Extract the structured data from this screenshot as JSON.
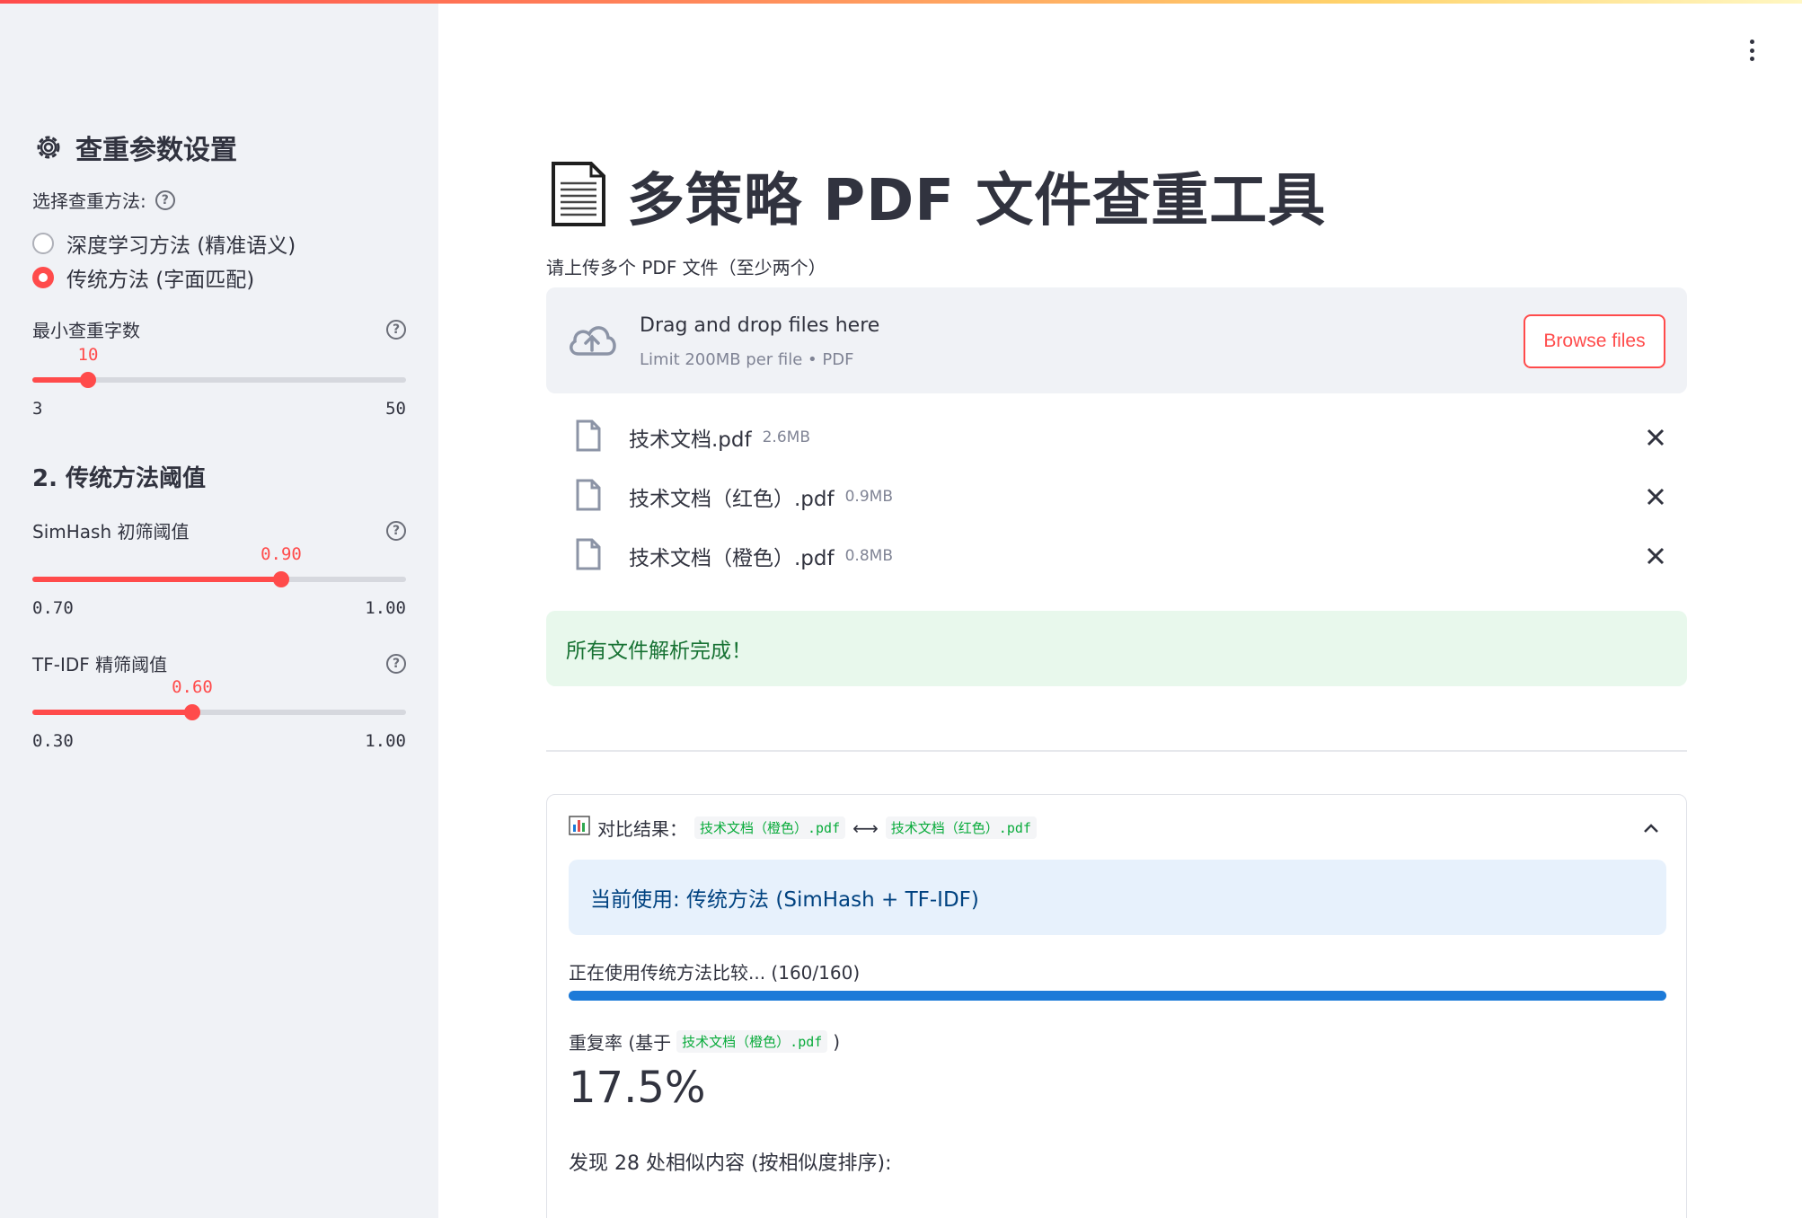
{
  "sidebar": {
    "header": "查重参数设置",
    "method_label": "选择查重方法:",
    "methods": [
      {
        "label": "深度学习方法 (精准语义)",
        "selected": false
      },
      {
        "label": "传统方法 (字面匹配)",
        "selected": true
      }
    ],
    "min_len": {
      "label": "最小查重字数",
      "value": "10",
      "min": "3",
      "max": "50",
      "fraction": 0.149
    },
    "section2": "2. 传统方法阈值",
    "simhash": {
      "label": "SimHash 初筛阈值",
      "value": "0.90",
      "min": "0.70",
      "max": "1.00",
      "fraction": 0.667
    },
    "tfidf": {
      "label": "TF-IDF 精筛阈值",
      "value": "0.60",
      "min": "0.30",
      "max": "1.00",
      "fraction": 0.429
    }
  },
  "main": {
    "title": "多策略 PDF 文件查重工具",
    "upload_label": "请上传多个 PDF 文件（至少两个）",
    "dropzone": {
      "title": "Drag and drop files here",
      "limit": "Limit 200MB per file • PDF",
      "browse": "Browse files"
    },
    "files": [
      {
        "name": "技术文档.pdf",
        "size": "2.6MB"
      },
      {
        "name": "技术文档（红色）.pdf",
        "size": "0.9MB"
      },
      {
        "name": "技术文档（橙色）.pdf",
        "size": "0.8MB"
      }
    ],
    "success_msg": "所有文件解析完成！",
    "expander": {
      "prefix": "对比结果：",
      "file_a": "技术文档（橙色）.pdf",
      "arrow": "⟷",
      "file_b": "技术文档（红色）.pdf",
      "info": "当前使用: 传统方法 (SimHash + TF-IDF)",
      "progress_label": "正在使用传统方法比较... (160/160)",
      "progress": 1.0,
      "metric_prefix": "重复率 (基于",
      "metric_file": "技术文档（橙色）.pdf",
      "metric_suffix": ")",
      "metric_value": "17.5%",
      "found": "发现 28 处相似内容 (按相似度排序):"
    }
  },
  "colors": {
    "accent": "#ff4b4b",
    "progress": "#1c7ad8",
    "success_bg": "#e8f8ec",
    "info_bg": "#e7f1fc"
  }
}
